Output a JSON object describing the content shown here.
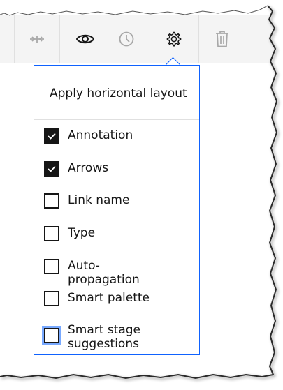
{
  "toolbar": {
    "buttons": [
      {
        "icon": "collapse-icon",
        "enabled": false
      },
      {
        "icon": "eye-icon",
        "enabled": true
      },
      {
        "icon": "clock-icon",
        "enabled": false
      },
      {
        "icon": "gear-icon",
        "enabled": true
      },
      {
        "icon": "trash-icon",
        "enabled": false
      }
    ]
  },
  "settings_menu": {
    "title": "Apply horizontal layout",
    "options": [
      {
        "label": "Annotation",
        "checked": true
      },
      {
        "label": "Arrows",
        "checked": true
      },
      {
        "label": "Link name",
        "checked": false
      },
      {
        "label": "Type",
        "checked": false
      },
      {
        "label": "Auto-propagation",
        "checked": false
      },
      {
        "label": "Smart palette",
        "checked": false
      },
      {
        "label": "Smart stage suggestions",
        "checked": false,
        "focused": true
      }
    ]
  },
  "colors": {
    "accent": "#0f62fe",
    "focus": "#78a9ff",
    "text": "#161616",
    "toolbar_bg": "#f4f4f4"
  }
}
